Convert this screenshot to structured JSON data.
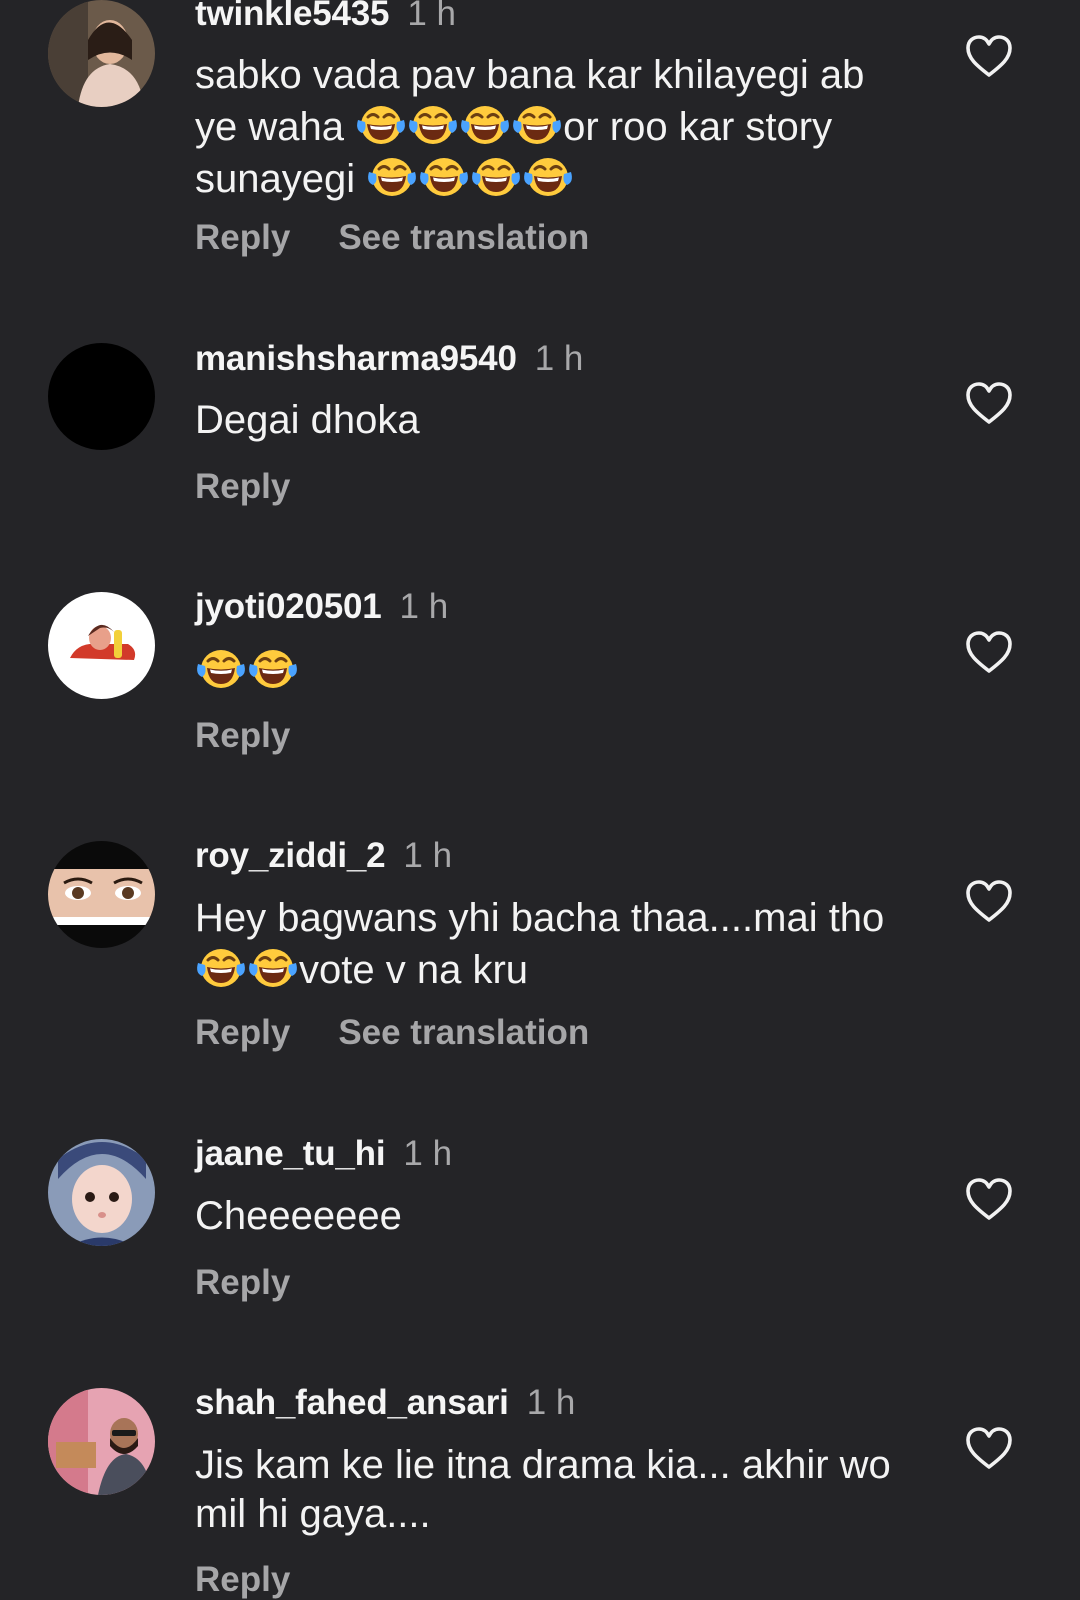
{
  "comments": [
    {
      "username": "twinkle5435",
      "time": "1 h",
      "text_parts": [
        "sabko vada pav bana kar khilayegi ab ye waha ",
        "or roo kar story sunayegi "
      ],
      "reply_label": "Reply",
      "translate_label": "See translation"
    },
    {
      "username": "manishsharma9540",
      "time": "1 h",
      "text": "Degai dhoka",
      "reply_label": "Reply"
    },
    {
      "username": "jyoti020501",
      "time": "1 h",
      "reply_label": "Reply"
    },
    {
      "username": "roy_ziddi_2",
      "time": "1 h",
      "text_parts": [
        "Hey bagwans yhi bacha thaa....mai tho ",
        "vote v na kru"
      ],
      "reply_label": "Reply",
      "translate_label": "See translation"
    },
    {
      "username": "jaane_tu_hi",
      "time": "1 h",
      "text": "Cheeeeeee",
      "reply_label": "Reply"
    },
    {
      "username": "shah_fahed_ansari",
      "time": "1 h",
      "text": "Jis kam ke lie itna drama kia... akhir wo mil hi gaya....",
      "reply_label": "Reply"
    }
  ],
  "icons": {
    "like": "heart-outline-icon",
    "emoji": "face-with-tears-of-joy-emoji"
  },
  "colors": {
    "background": "#242427",
    "text": "#f3f3f3",
    "muted": "#a6a6a8"
  }
}
